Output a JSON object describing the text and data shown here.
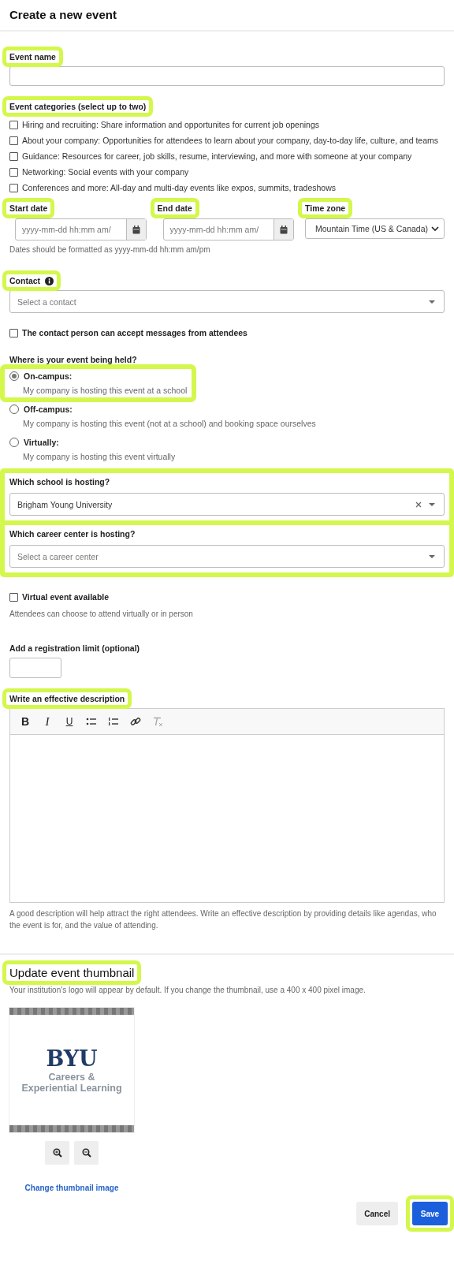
{
  "header": {
    "title": "Create a new event"
  },
  "event_name": {
    "label": "Event name",
    "highlighted": true
  },
  "categories": {
    "label": "Event categories (select up to two)",
    "highlighted": true,
    "options": [
      {
        "label": "Hiring and recruiting: Share information and opportunites for current job openings",
        "checked": false
      },
      {
        "label": "About your company: Opportunities for attendees to learn about your company, day-to-day life, culture, and teams",
        "checked": false
      },
      {
        "label": "Guidance: Resources for career, job skills, resume, interviewing, and more with someone at your company",
        "checked": false
      },
      {
        "label": "Networking: Social events with your company",
        "checked": false
      },
      {
        "label": "Conferences and more: All-day and multi-day events like expos, summits, tradeshows",
        "checked": false
      }
    ]
  },
  "dates": [
    {
      "kind": "date",
      "label": "Start date",
      "placeholder": "yyyy-mm-dd hh:mm am/",
      "highlighted": true
    },
    {
      "kind": "date",
      "label": "End date",
      "placeholder": "yyyy-mm-dd hh:mm am/",
      "highlighted": true
    },
    {
      "kind": "select",
      "label": "Time zone",
      "value": "Mountain Time (US & Canada)",
      "highlighted": true
    }
  ],
  "dates_hint": "Dates should be formatted as yyyy-mm-dd hh:mm am/pm",
  "contact": {
    "label": "Contact",
    "highlighted": true,
    "placeholder": "Select a contact"
  },
  "contact_messages": {
    "label": "The contact person can accept messages from attendees",
    "checked": false
  },
  "location": {
    "label": "Where is your event being held?",
    "options": [
      {
        "label": "On-campus:",
        "description": "My company is hosting this event at a school",
        "selected": true,
        "highlighted": true
      },
      {
        "label": "Off-campus:",
        "description": "My company is hosting this event (not at a school) and booking space ourselves",
        "selected": false,
        "highlighted": false
      },
      {
        "label": "Virtually:",
        "description": "My company is hosting this event virtually",
        "selected": false,
        "highlighted": false
      }
    ]
  },
  "school": {
    "label": "Which school is hosting?",
    "value": "Brigham Young University",
    "highlighted": true
  },
  "career_center": {
    "label": "Which career center is hosting?",
    "placeholder": "Select a career center",
    "highlighted": true
  },
  "virtual": {
    "label": "Virtual event available",
    "checked": false,
    "description": "Attendees can choose to attend virtually or in person"
  },
  "registration_limit": {
    "label": "Add a registration limit (optional)"
  },
  "description": {
    "label": "Write an effective description",
    "highlighted": true,
    "toolbar": [
      {
        "kind": "bold",
        "text": "B"
      },
      {
        "kind": "italic",
        "text": "I"
      },
      {
        "kind": "underline",
        "text": "U"
      },
      {
        "kind": "bullets"
      },
      {
        "kind": "numbers"
      },
      {
        "kind": "link"
      },
      {
        "kind": "clear"
      }
    ],
    "hint": "A good description will help attract the right attendees. Write an effective description by providing details like agendas, who the event is for, and the value of attending."
  },
  "thumbnail": {
    "title": "Update event thumbnail",
    "highlighted": true,
    "description": "Your institution's logo will appear by default. If you change the thumbnail, use a 400 x 400 pixel image.",
    "logo": {
      "name": "BYU",
      "lines": [
        "Careers &",
        "Experiential Learning"
      ]
    },
    "link": "Change thumbnail image"
  },
  "actions": [
    {
      "kind": "secondary",
      "label": "Cancel",
      "highlighted": false
    },
    {
      "kind": "primary",
      "label": "Save",
      "highlighted": true
    }
  ]
}
